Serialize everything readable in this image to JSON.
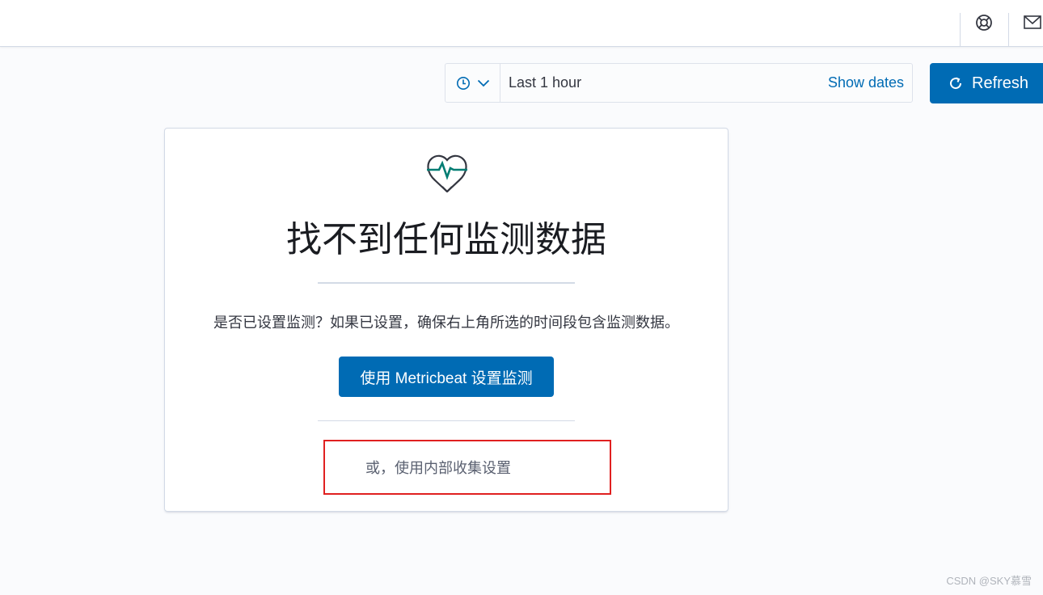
{
  "header": {
    "help_icon": "help-icon",
    "mail_icon": "mail-icon"
  },
  "datepicker": {
    "quick_icon": "clock-icon",
    "range_label": "Last 1 hour",
    "show_dates_label": "Show dates"
  },
  "refresh": {
    "label": "Refresh",
    "icon": "refresh-icon"
  },
  "panel": {
    "icon": "heart-pulse-icon",
    "title": "找不到任何监测数据",
    "description": "是否已设置监测？如果已设置，确保右上角所选的时间段包含监测数据。",
    "primary_button_label": "使用 Metricbeat 设置监测",
    "secondary_link_label": "或，使用内部收集设置"
  },
  "watermark": "CSDN @SKY慕雪",
  "colors": {
    "accent": "#006bb4",
    "highlight_box": "#e02020",
    "heart_teal": "#017d73"
  }
}
